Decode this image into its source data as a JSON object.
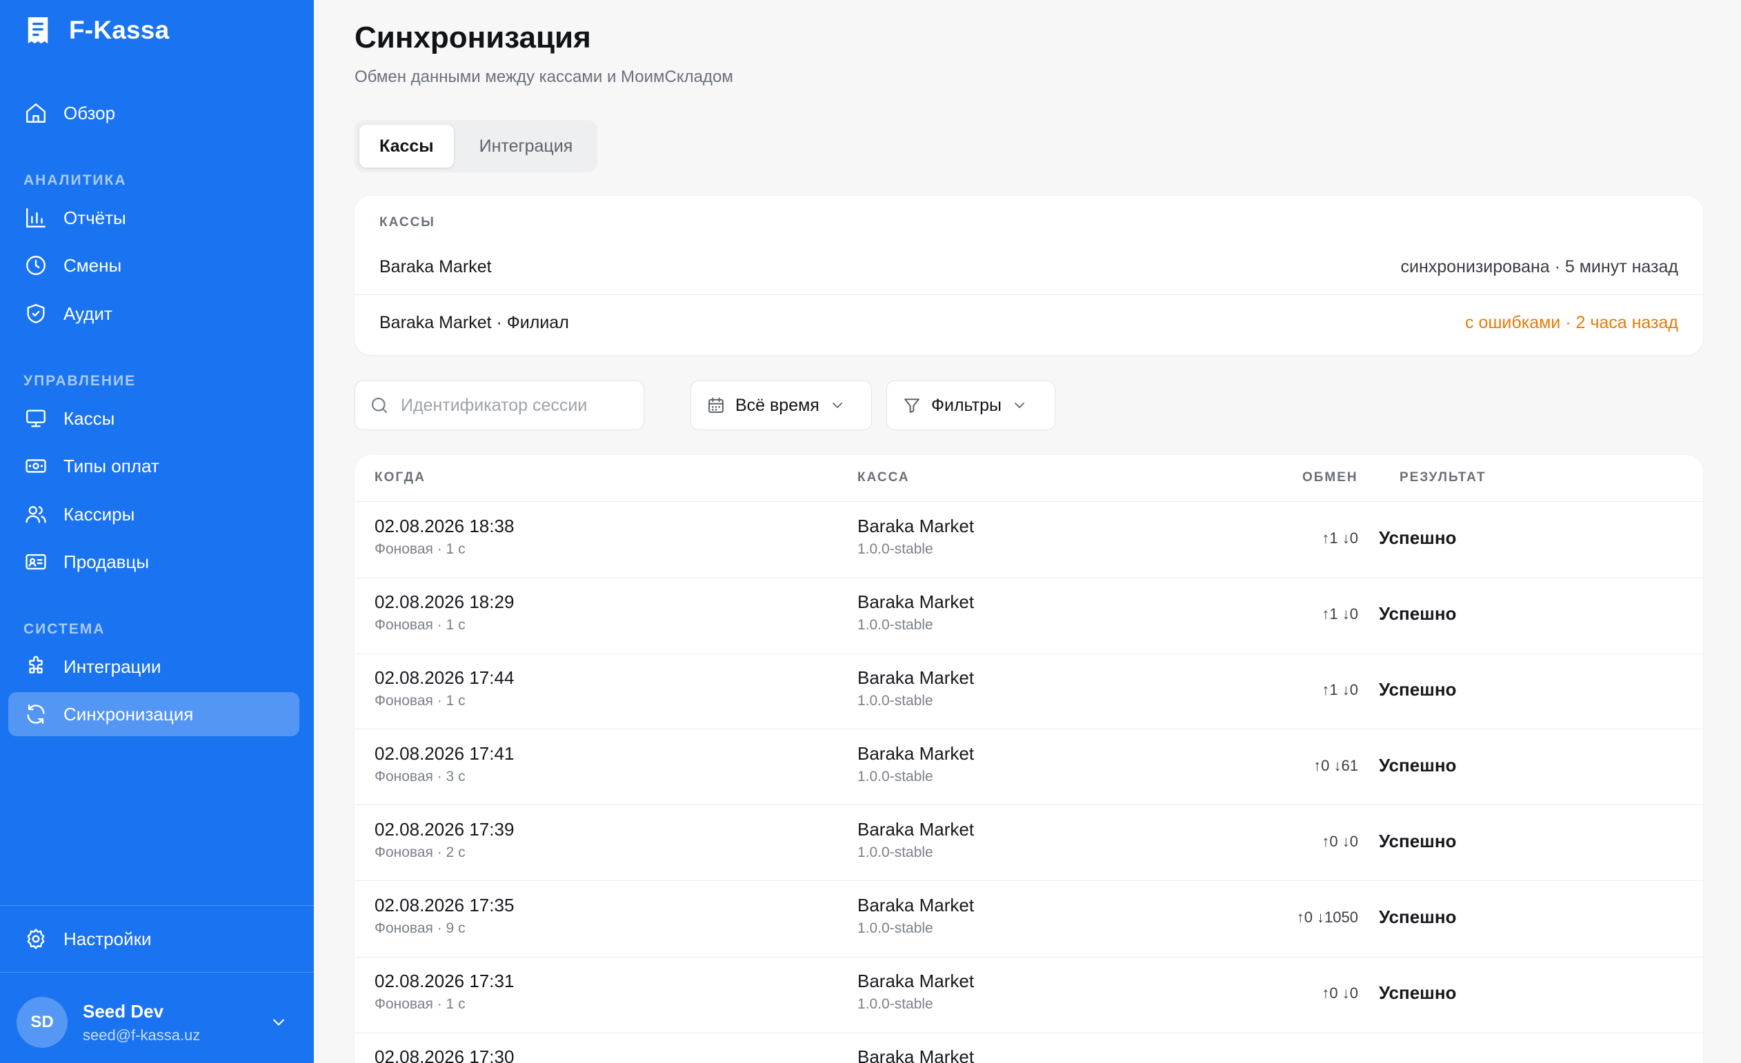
{
  "app": {
    "brand": "F-Kassa",
    "icons": {
      "logo": "receipt-icon"
    }
  },
  "sidebar": {
    "overview": "Обзор",
    "sections": {
      "analytics": "АНАЛИТИКА",
      "management": "УПРАВЛЕНИЕ",
      "system": "СИСТЕМА"
    },
    "items": {
      "reports": "Отчёты",
      "shifts": "Смены",
      "audit": "Аудит",
      "registers": "Кассы",
      "payment_types": "Типы оплат",
      "cashiers": "Кассиры",
      "sellers": "Продавцы",
      "integrations": "Интеграции",
      "sync": "Синхронизация"
    },
    "active": "sync",
    "settings": "Настройки",
    "user": {
      "initials": "SD",
      "name": "Seed Dev",
      "email": "seed@f-kassa.uz"
    }
  },
  "page": {
    "title": "Синхронизация",
    "subtitle": "Обмен данными между кассами и МоимСкладом",
    "tabs": [
      "Кассы",
      "Интеграция"
    ],
    "active_tab": "Кассы"
  },
  "registers_card": {
    "label": "КАССЫ",
    "rows": [
      {
        "name": "Baraka Market",
        "status": "синхронизирована · 5 минут назад",
        "state": "ok"
      },
      {
        "name": "Baraka Market · Филиал",
        "status": "с ошибками · 2 часа назад",
        "state": "error"
      }
    ]
  },
  "filters": {
    "search_placeholder": "Идентификатор сессии",
    "search_value": "",
    "period": "Всё время",
    "filters_label": "Фильтры"
  },
  "sessions_table": {
    "headers": {
      "when": "КОГДА",
      "register": "КАССА",
      "exchange": "ОБМЕН",
      "result": "РЕЗУЛЬТАТ"
    },
    "rows": [
      {
        "when": "02.08.2026 18:38",
        "meta": "Фоновая · 1 с",
        "register": "Baraka Market",
        "version": "1.0.0-stable",
        "exchange": "↑1 ↓0",
        "result": "Успешно"
      },
      {
        "when": "02.08.2026 18:29",
        "meta": "Фоновая · 1 с",
        "register": "Baraka Market",
        "version": "1.0.0-stable",
        "exchange": "↑1 ↓0",
        "result": "Успешно"
      },
      {
        "when": "02.08.2026 17:44",
        "meta": "Фоновая · 1 с",
        "register": "Baraka Market",
        "version": "1.0.0-stable",
        "exchange": "↑1 ↓0",
        "result": "Успешно"
      },
      {
        "when": "02.08.2026 17:41",
        "meta": "Фоновая · 3 с",
        "register": "Baraka Market",
        "version": "1.0.0-stable",
        "exchange": "↑0 ↓61",
        "result": "Успешно"
      },
      {
        "when": "02.08.2026 17:39",
        "meta": "Фоновая · 2 с",
        "register": "Baraka Market",
        "version": "1.0.0-stable",
        "exchange": "↑0 ↓0",
        "result": "Успешно"
      },
      {
        "when": "02.08.2026 17:35",
        "meta": "Фоновая · 9 с",
        "register": "Baraka Market",
        "version": "1.0.0-stable",
        "exchange": "↑0 ↓1050",
        "result": "Успешно"
      },
      {
        "when": "02.08.2026 17:31",
        "meta": "Фоновая · 1 с",
        "register": "Baraka Market",
        "version": "1.0.0-stable",
        "exchange": "↑0 ↓0",
        "result": "Успешно"
      },
      {
        "when": "02.08.2026 17:30",
        "meta": "",
        "register": "Baraka Market",
        "version": "",
        "exchange": "",
        "result": ""
      }
    ]
  },
  "colors": {
    "sidebar_bg": "#1a73f0",
    "error": "#ea7a06"
  }
}
